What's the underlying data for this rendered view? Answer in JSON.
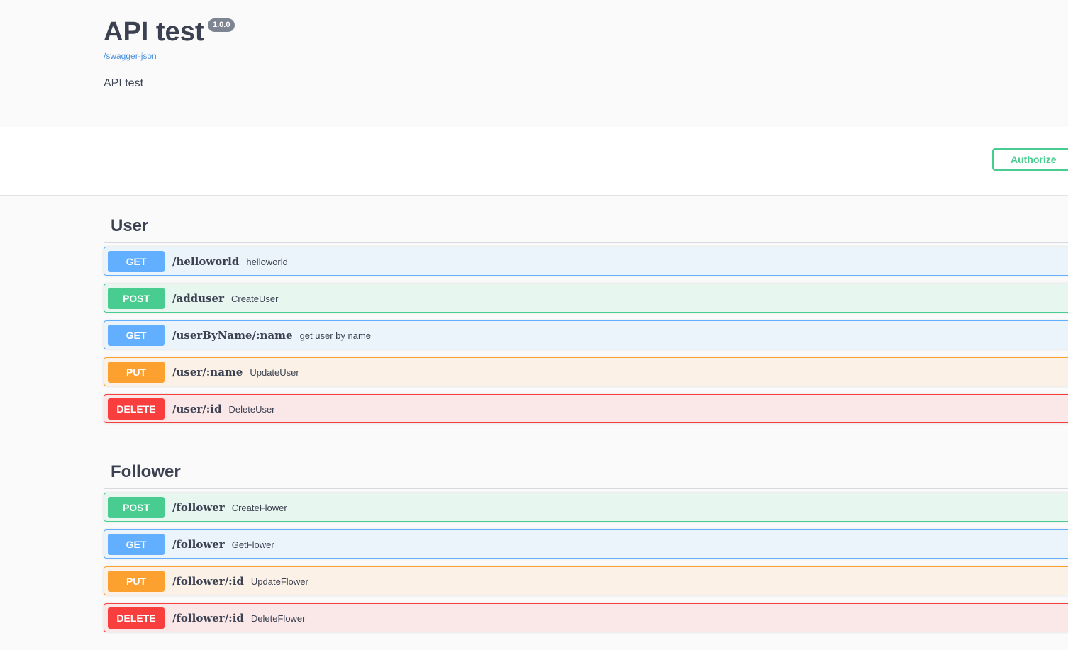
{
  "info": {
    "title": "API test",
    "version": "1.0.0",
    "spec_link": "/swagger-json",
    "description": "API test"
  },
  "toolbar": {
    "authorize_label": "Authorize"
  },
  "tags": [
    {
      "name": "User",
      "operations": [
        {
          "method": "GET",
          "path": "/helloworld",
          "summary": "helloworld"
        },
        {
          "method": "POST",
          "path": "/adduser",
          "summary": "CreateUser"
        },
        {
          "method": "GET",
          "path": "/userByName/:name",
          "summary": "get user by name"
        },
        {
          "method": "PUT",
          "path": "/user/:name",
          "summary": "UpdateUser"
        },
        {
          "method": "DELETE",
          "path": "/user/:id",
          "summary": "DeleteUser"
        }
      ]
    },
    {
      "name": "Follower",
      "operations": [
        {
          "method": "POST",
          "path": "/follower",
          "summary": "CreateFlower"
        },
        {
          "method": "GET",
          "path": "/follower",
          "summary": "GetFlower"
        },
        {
          "method": "PUT",
          "path": "/follower/:id",
          "summary": "UpdateFlower"
        },
        {
          "method": "DELETE",
          "path": "/follower/:id",
          "summary": "DeleteFlower"
        }
      ]
    }
  ],
  "colors": {
    "get": "#61affe",
    "post": "#49cc90",
    "put": "#fca130",
    "delete": "#f93e3e"
  }
}
